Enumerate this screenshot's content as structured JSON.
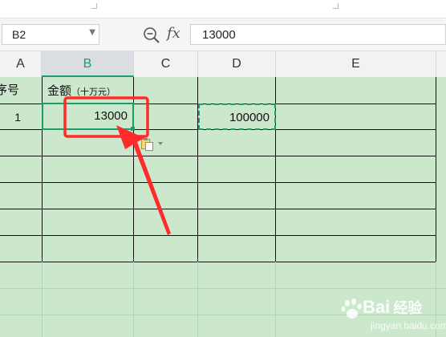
{
  "name_box": {
    "value": "B2"
  },
  "formula_bar": {
    "value": "13000"
  },
  "toolbar": {
    "fx_label": "fx"
  },
  "columns": [
    "A",
    "B",
    "C",
    "D",
    "E"
  ],
  "headers": {
    "a1": "序号",
    "b1": "金额",
    "b1_unit": "（十万元）"
  },
  "cells": {
    "a2": "1",
    "b2": "13000",
    "d2": "100000"
  },
  "colors": {
    "sheet_bg": "#cce8cc",
    "selection": "#1b9d6b",
    "annotation": "#ff2a2a",
    "copy_marquee": "#1b9d6b"
  },
  "watermark": {
    "brand": "Bai",
    "brand_suffix": "经验",
    "url": "jingyan.baidu.com"
  }
}
